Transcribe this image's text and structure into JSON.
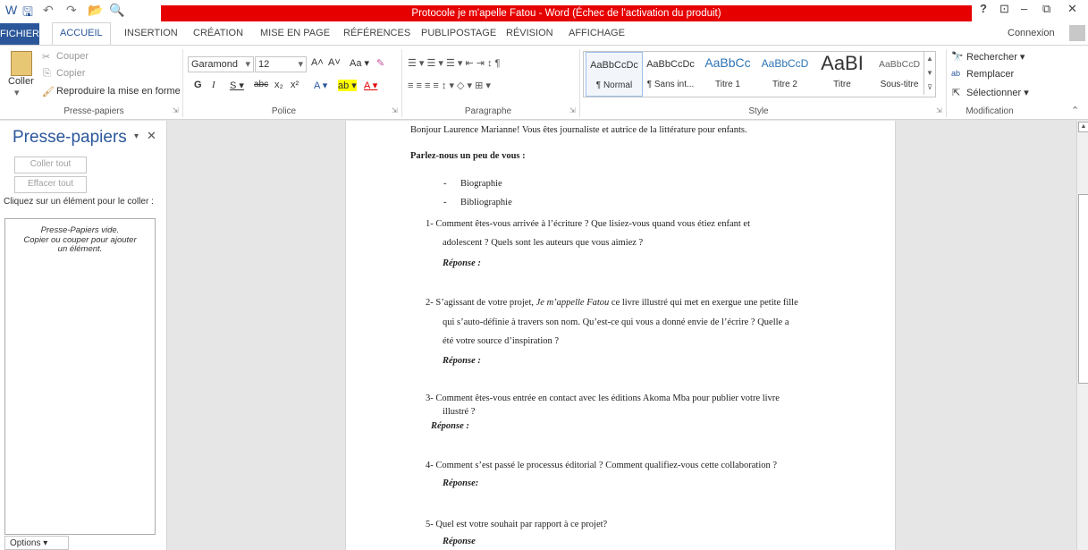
{
  "window": {
    "title": "Protocole je m'apelle Fatou -  Word (Échec de l'activation du produit)",
    "help": "?",
    "restore_ribbon": "⊡",
    "minimize": "–",
    "restore": "⧉",
    "close": "✕"
  },
  "qat": {
    "word_icon": "W",
    "save": "🖫",
    "undo": "↶",
    "redo": "↷",
    "open": "📂",
    "preview": "🔍"
  },
  "tabs": [
    "FICHIER",
    "ACCUEIL",
    "INSERTION",
    "CRÉATION",
    "MISE EN PAGE",
    "RÉFÉRENCES",
    "PUBLIPOSTAGE",
    "RÉVISION",
    "AFFICHAGE"
  ],
  "account": "Connexion",
  "clipboard_group": {
    "paste": "Coller",
    "cut": "Couper",
    "copy": "Copier",
    "format_painter": "Reproduire la mise en forme",
    "label": "Presse-papiers"
  },
  "font_group": {
    "font": "Garamond",
    "size": "12",
    "label": "Police",
    "row1": [
      "A˄",
      "A˅",
      "Aa ▾",
      "✎"
    ],
    "row2": [
      "G",
      "I",
      "S ▾",
      "abc",
      "x₂",
      "x²",
      "A ▾",
      "ab ▾",
      "A ▾"
    ]
  },
  "paragraph_group": {
    "label": "Paragraphe",
    "row1": "☰ ▾  ☰ ▾  ☰ ▾   ⇤ ⇥   ↕   ¶",
    "row2": "≡  ≡  ≡  ≡   ↕ ▾   ◇ ▾  ⊞ ▾"
  },
  "styles_group": {
    "label": "Style",
    "items": [
      {
        "preview": "AaBbCcDc",
        "name": "¶ Normal"
      },
      {
        "preview": "AaBbCcDc",
        "name": "¶ Sans int..."
      },
      {
        "preview": "AaBbCc",
        "name": "Titre 1"
      },
      {
        "preview": "AaBbCcD",
        "name": "Titre 2"
      },
      {
        "preview": "AaBI",
        "name": "Titre"
      },
      {
        "preview": "AaBbCcD",
        "name": "Sous-titre"
      }
    ]
  },
  "editing_group": {
    "find": "Rechercher",
    "replace": "Remplacer",
    "select": "Sélectionner",
    "label": "Modification"
  },
  "pane": {
    "title": "Presse-papiers",
    "paste_all": "Coller tout",
    "clear_all": "Effacer tout",
    "instruction": "Cliquez sur un élément pour le coller :",
    "empty_line1": "Presse-Papiers vide.",
    "empty_line2": "Copier ou couper pour ajouter",
    "empty_line3": "un élément.",
    "options": "Options ▾"
  },
  "document": {
    "intro": "Bonjour Laurence Marianne! Vous êtes journaliste et autrice de la littérature pour enfants.",
    "heading": "Parlez-nous un peu de vous :",
    "bullets": [
      "Biographie",
      "Bibliographie"
    ],
    "q1_a": "1-  Comment êtes-vous arrivée à l’écriture ? Que lisiez-vous quand vous étiez enfant et",
    "q1_b": "adolescent ? Quels sont les auteurs que vous aimiez ?",
    "r1": "Réponse :",
    "q2_a1": "2-  S’agissant de votre projet, ",
    "q2_a_title": "Je m’appelle Fatou",
    "q2_a2": " ce livre illustré qui met en exergue une petite fille",
    "q2_b": "qui s’auto-définie à travers son nom. Qu’est-ce qui vous a donné envie de l’écrire ? Quelle a",
    "q2_c": "été votre source d’inspiration ?",
    "r2": "Réponse :",
    "q3_a": "3-  Comment êtes-vous entrée en contact avec les éditions Akoma Mba pour publier votre livre",
    "q3_b": "illustré ?",
    "r3": "Réponse :",
    "q4": "4-  Comment s’est passé le processus éditorial ? Comment qualifiez-vous cette collaboration ?",
    "r4": "Réponse:",
    "q5": "5-  Quel est votre souhait par rapport à ce projet?",
    "r5": "Réponse"
  }
}
